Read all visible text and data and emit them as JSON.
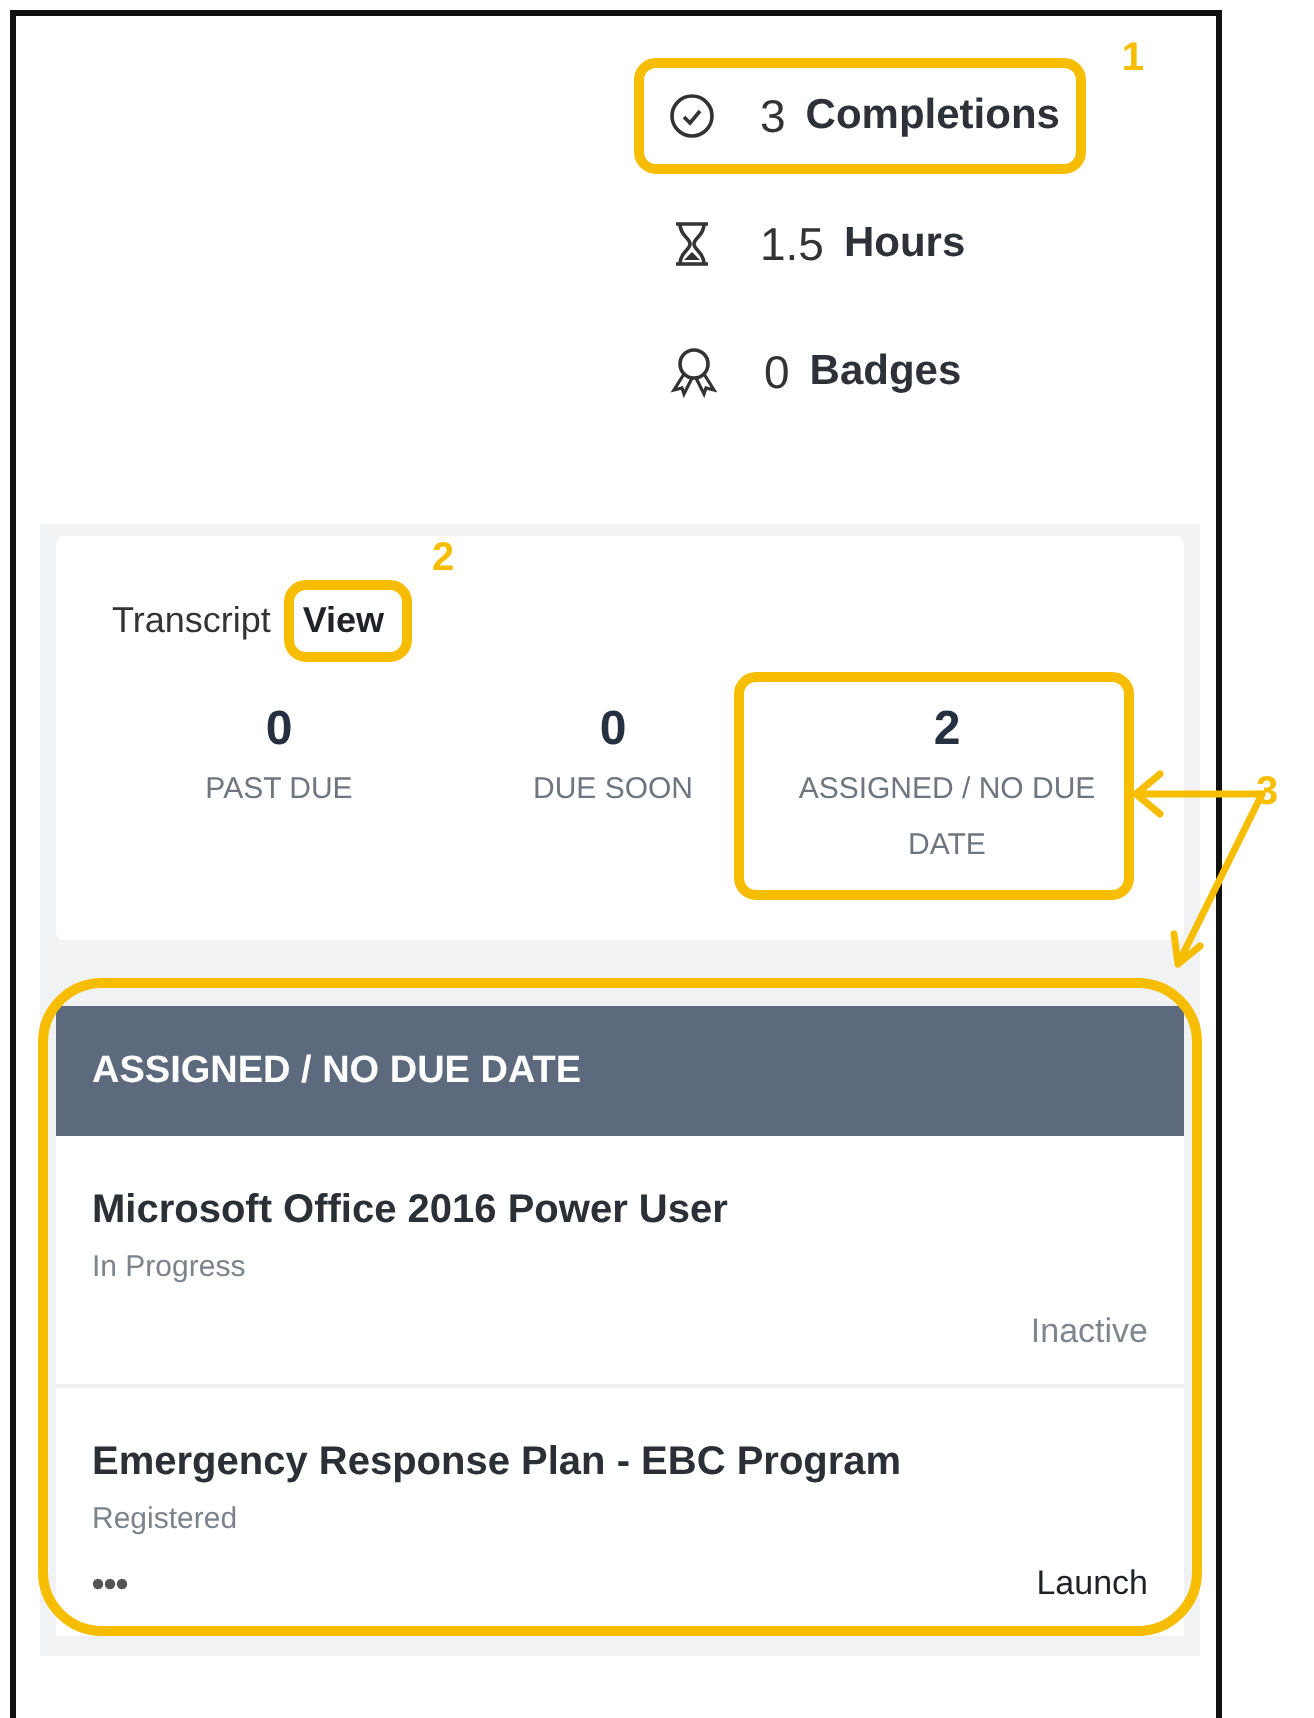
{
  "stats": [
    {
      "kind": "check",
      "value": "3",
      "label": "Completions",
      "callout": "1"
    },
    {
      "kind": "hourglass",
      "value": "1.5",
      "label": "Hours"
    },
    {
      "kind": "badge",
      "value": "0",
      "label": "Badges"
    }
  ],
  "transcript": {
    "label": "Transcript",
    "link": "View",
    "callout": "2"
  },
  "summary": [
    {
      "count": "0",
      "label": "PAST DUE"
    },
    {
      "count": "0",
      "label": "DUE SOON"
    },
    {
      "count": "2",
      "label": "ASSIGNED / NO DUE DATE",
      "callout": "3"
    }
  ],
  "section": {
    "title": "ASSIGNED / NO DUE DATE",
    "highlighted": true,
    "items": [
      {
        "title": "Microsoft Office 2016 Power User",
        "status": "In Progress",
        "action": "Inactive",
        "kind": "inactive"
      },
      {
        "title": "Emergency Response Plan - EBC Program",
        "status": "Registered",
        "action": "Launch",
        "kind": "launch"
      }
    ]
  }
}
